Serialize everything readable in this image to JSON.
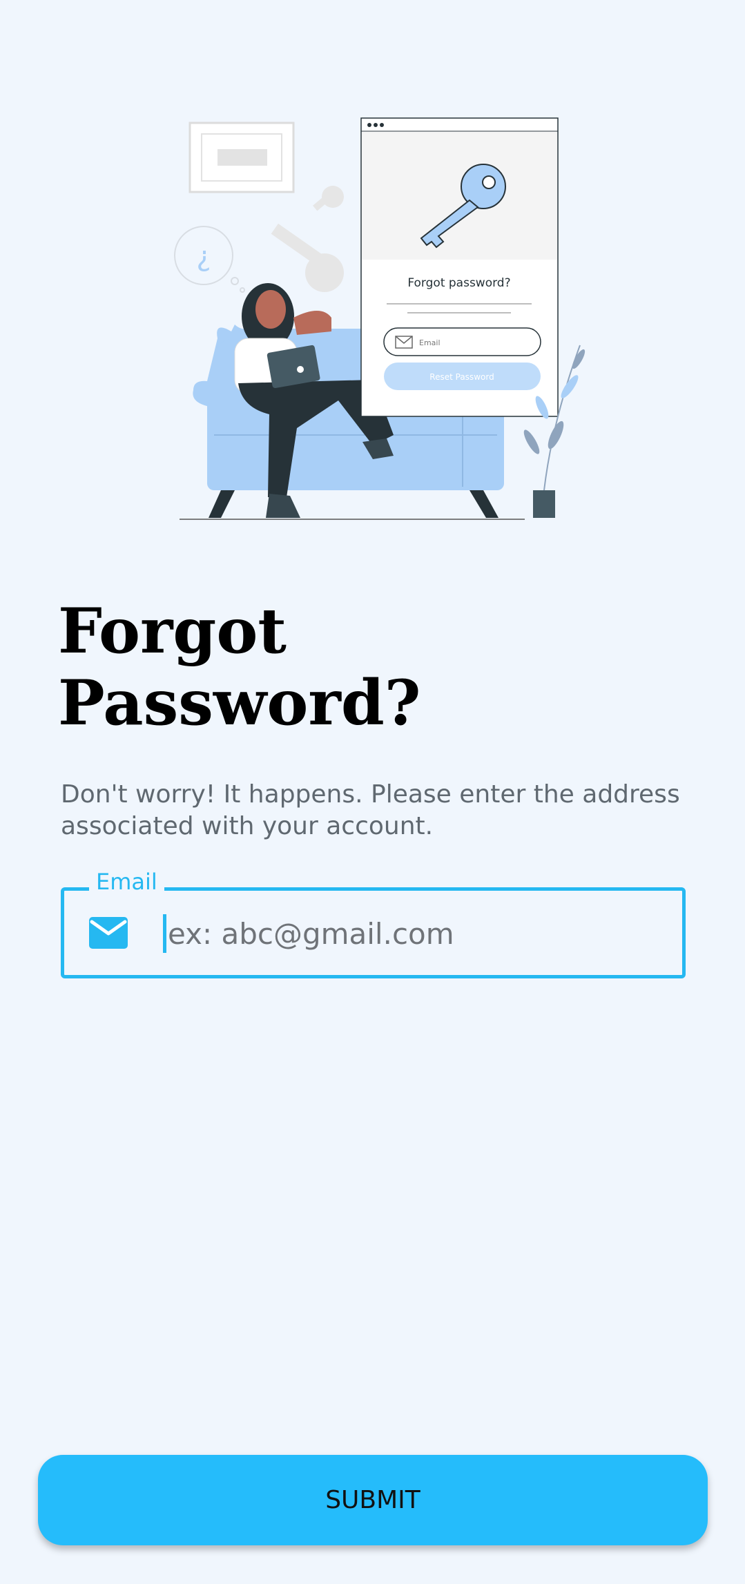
{
  "illustration": {
    "card_title": "Forgot password?",
    "card_email_placeholder": "Email",
    "card_button_label": "Reset Password",
    "question_mark": "¿"
  },
  "header": {
    "title_line1": "Forgot",
    "title_line2": "Password?",
    "subtitle": "Don't worry! It happens. Please enter the address associated with your account."
  },
  "form": {
    "email_label": "Email",
    "email_placeholder": "ex: abc@gmail.com",
    "email_value": "",
    "email_icon": "mail-icon"
  },
  "actions": {
    "submit_label": "SUBMIT"
  },
  "colors": {
    "background": "#f0f6fd",
    "accent": "#25b8f1",
    "button": "#25bcfb",
    "illustration_blue": "#a9cff7"
  }
}
